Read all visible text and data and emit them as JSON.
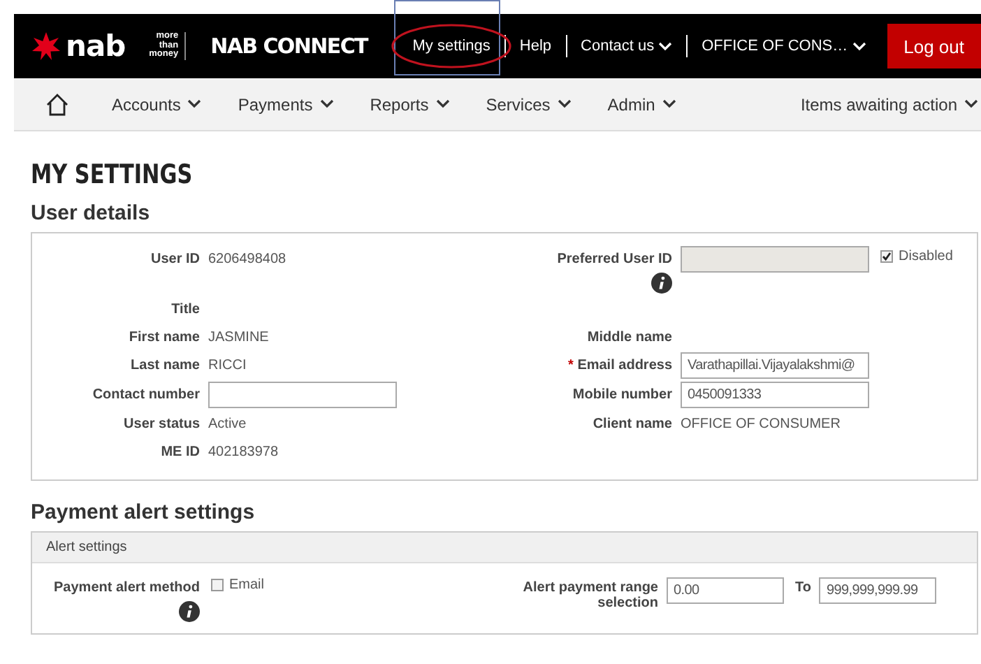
{
  "header": {
    "brand": "nab",
    "tagline": [
      "more",
      "than",
      "money"
    ],
    "product": "NAB CONNECT",
    "links": [
      {
        "label": "My settings",
        "dropdown": false,
        "circled": true
      },
      {
        "label": "Help",
        "dropdown": false,
        "circled": false
      },
      {
        "label": "Contact us",
        "dropdown": true,
        "circled": false
      },
      {
        "label": "OFFICE OF CONS…",
        "dropdown": true,
        "circled": false
      }
    ],
    "logout": "Log out"
  },
  "nav": {
    "items": [
      {
        "label": "Accounts"
      },
      {
        "label": "Payments"
      },
      {
        "label": "Reports"
      },
      {
        "label": "Services"
      },
      {
        "label": "Admin"
      }
    ],
    "right": "Items awaiting action"
  },
  "page_title": "MY SETTINGS",
  "user_details": {
    "heading": "User details",
    "rows": [
      {
        "left": {
          "label": "User ID",
          "kind": "text",
          "value": "6206498408"
        },
        "right": {
          "label": "Preferred User ID",
          "kind": "disabled_input",
          "info": true,
          "checkbox": {
            "label": "Disabled",
            "checked": true
          }
        }
      },
      {
        "left": {
          "label": "Title",
          "kind": "text"
        },
        "right": {
          "kind": "empty"
        }
      },
      {
        "left": {
          "label": "First name",
          "kind": "text",
          "value": "JASMINE"
        },
        "right": {
          "label": "Middle name",
          "kind": "text"
        }
      },
      {
        "left": {
          "label": "Last name",
          "kind": "text",
          "value": "RICCI"
        },
        "right": {
          "label": "Email address",
          "kind": "input",
          "marker": "*",
          "value": "Varathapillai.Vijayalakshmi@"
        }
      },
      {
        "left": {
          "label": "Contact number",
          "kind": "input"
        },
        "right": {
          "label": "Mobile number",
          "kind": "input",
          "value": "0450091333"
        }
      },
      {
        "left": {
          "label": "User status",
          "kind": "text",
          "value": "Active"
        },
        "right": {
          "label": "Client name",
          "kind": "text",
          "value": "OFFICE OF CONSUMER"
        }
      },
      {
        "left": {
          "label": "ME ID",
          "kind": "text",
          "value": "402183978"
        },
        "right": {
          "kind": "empty"
        }
      }
    ]
  },
  "payment_alerts": {
    "heading": "Payment alert settings",
    "panel_title": "Alert settings",
    "method": {
      "label": "Payment alert method",
      "info": true,
      "option": {
        "label": "Email",
        "checked": false
      }
    },
    "range": {
      "label": "Alert payment range selection",
      "from": "0.00",
      "to_label": "To",
      "to": "999,999,999.99"
    }
  }
}
